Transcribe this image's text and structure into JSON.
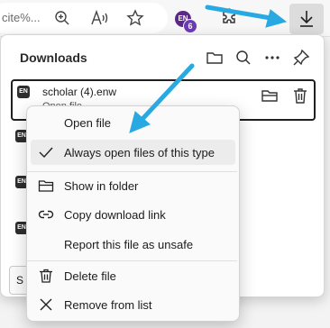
{
  "browser": {
    "url_fragment": "cite%...",
    "profile_initials": "EN",
    "profile_badge": "6"
  },
  "downloads_panel": {
    "title": "Downloads",
    "items": [
      {
        "badge": "EN",
        "name": "scholar (4).enw",
        "subtext": "Open file"
      },
      {
        "badge": "EN"
      },
      {
        "badge": "EN"
      },
      {
        "badge": "EN"
      }
    ],
    "bottom_button_label": "S"
  },
  "context_menu": {
    "items": [
      {
        "label": "Open file",
        "icon": "none"
      },
      {
        "label": "Always open files of this type",
        "icon": "checkmark-icon",
        "checked": true
      },
      {
        "label": "Show in folder",
        "icon": "folder-icon"
      },
      {
        "label": "Copy download link",
        "icon": "link-icon"
      },
      {
        "label": "Report this file as unsafe",
        "icon": "none"
      },
      {
        "label": "Delete file",
        "icon": "trash-icon"
      },
      {
        "label": "Remove from list",
        "icon": "close-icon"
      }
    ]
  },
  "colors": {
    "annotation_arrow": "#29a9e1",
    "menu_highlight": "#ececec",
    "profile_avatar": "#5b2a86"
  }
}
